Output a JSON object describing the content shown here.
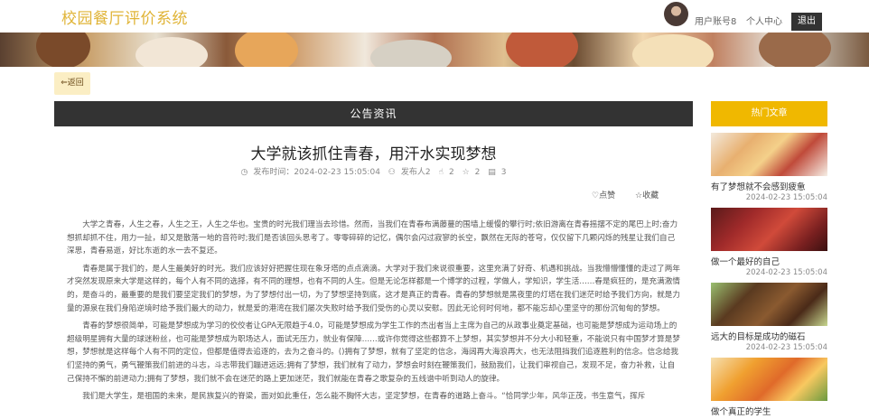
{
  "header": {
    "site_title": "校园餐厅评价系统",
    "user_account": "用户账号8",
    "personal_center": "个人中心",
    "logout": "退出"
  },
  "back_label": "⇐返回",
  "section_title": "公告资讯",
  "article": {
    "title": "大学就该抓住青春，用汗水实现梦想",
    "publish_time": "发布时间：2024-02-23 15:05:04",
    "publisher": "发布人2",
    "likes": "2",
    "favorites": "2",
    "comments": "3",
    "like_label": "点赞",
    "collect_label": "收藏",
    "paragraphs": [
      "大学之青春，人生之春，人生之王，人生之华也。宝贵的时光我们理当去珍惜。然而，当我们在青春布满藤蔓的围墙上缓慢的攀行时;依旧游离在青春摇摆不定的尾巴上时;奋力想抓却抓不住，用力一扯，却又是散落一地的音符时;我们是否该回头思考了。零零碎碎的记忆，偶尔会闪过寂寥的长空，飘然在无际的苍穹，仅仅留下几颗闪烁的残星让我们自己深思，青春易逝，好比东逝的水一去不复还。",
      "青春是属于我们的，是人生最美好的时光。我们应该好好把握住现在象牙塔的点点滴滴。大学对于我们来说很重要，这里充满了好奇、机遇和挑战。当我懵懵懂懂的走过了两年才突然发现原来大学是这样的，每个人有不同的选择，有不同的理想，也有不同的人生。但是无论怎样都是一个博学的过程，学做人，学知识，学生活……春是疯狂的，是充满激情的，是奋斗的，最重要的是我们要坚定我们的梦想，为了梦想付出一切，为了梦想坚持到底，这才是真正的青春。青春的梦想就是黑夜里的灯塔在我们迷茫时给予我们方向，就是力量的源泉在我们身陷逆境时给予我们最大的动力，就是爱的港湾在我们屡次失败时给予我们受伤的心灵以安慰。因此无论何时何地，都不能忘却心里坚守的那份沉甸甸的梦想。",
      "青春的梦想很简单，可能是梦想成为学习的佼佼者让GPA无限趋于4.0，可能是梦想成为学生工作的杰出者当上主席为自己的从政事业奠定基础，也可能是梦想成为运动场上的超级明星拥有大量的球迷粉丝，也可能是梦想成为职场达人，面试无压力，就业有保障……或许你觉得这些都算不上梦想，其实梦想并不分大小和轻重，不能说只有中国梦才算是梦想，梦想就是这样每个人有不同的定位，但都是值得去追逐的，去为之奋斗的。()拥有了梦想，就有了坚定的信念，海阔再大海浪再大，也无法阻挡我们追逐胜利的信念。信念给我们坚持的勇气，勇气鞭策我们前进的斗志，斗志带我们蹦进远远;拥有了梦想，我们就有了动力，梦想会时刻在鞭策我们，鼓励我们，让我们审视自己，发现不足，奋力补救，让自己保持不懈的前进动力;拥有了梦想，我们就不会在迷茫的路上更加迷茫，我们就能在青春之歌复杂的五线谱中听到动人的旋律。",
      "我们是大学生，是祖国的未来，是民族复兴的脊梁，面对如此重任，怎么能不胸怀大志，坚定梦想，在青春的道路上奋斗。“恰同学少年，风华正茂，书生意气，挥斥"
    ]
  },
  "sidebar": {
    "title": "热门文章",
    "items": [
      {
        "title": "有了梦想就不会感到疲惫",
        "date": "2024-02-23 15:05:04"
      },
      {
        "title": "做一个最好的自己",
        "date": "2024-02-23 15:05:04"
      },
      {
        "title": "远大的目标是成功的磁石",
        "date": "2024-02-23 15:05:04"
      },
      {
        "title": "做个真正的学生",
        "date": ""
      }
    ]
  }
}
